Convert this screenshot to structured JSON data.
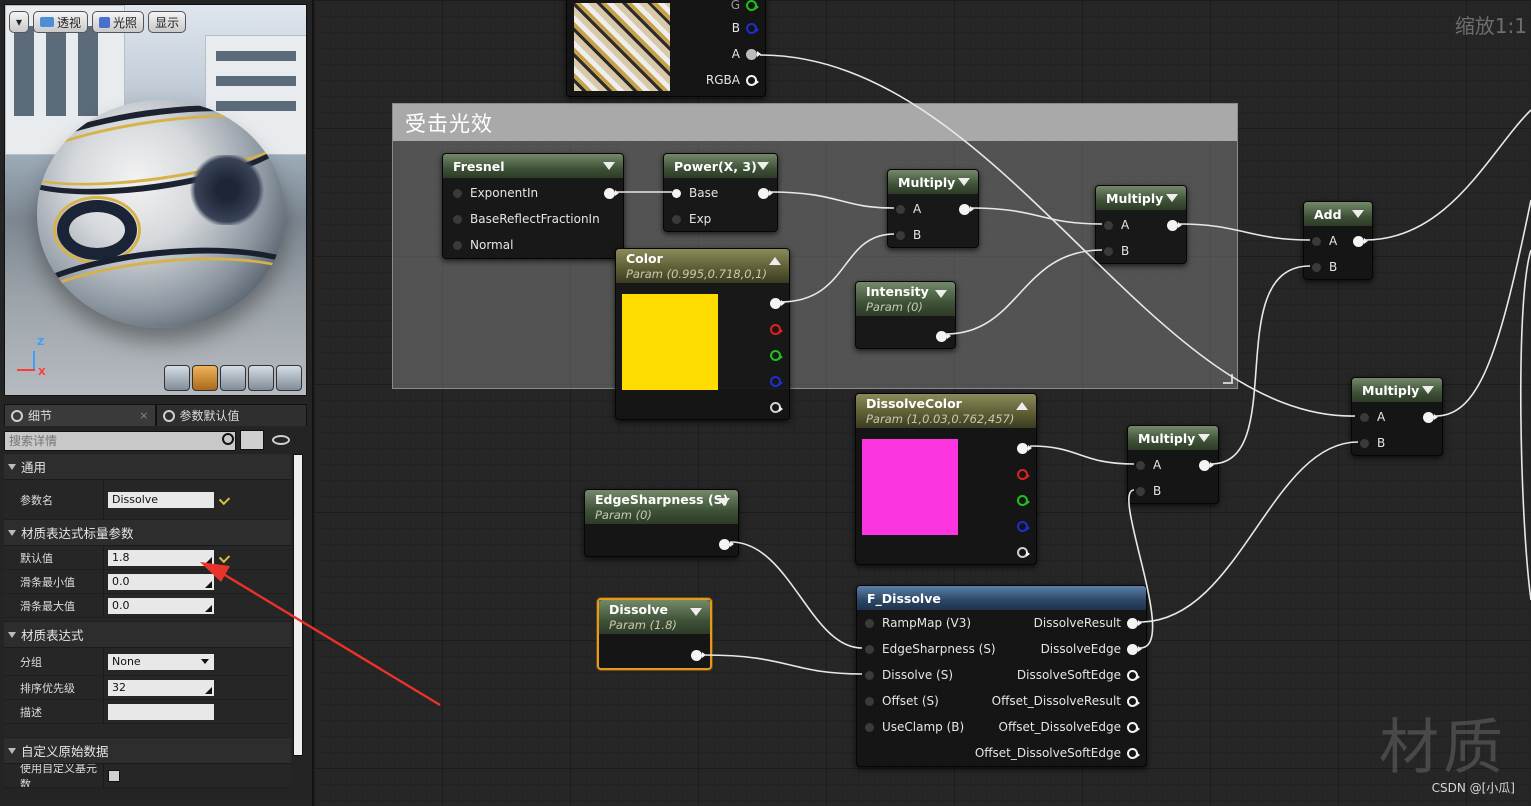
{
  "viewport": {
    "toolbar": {
      "menu_label": "▾",
      "perspective_label": "透视",
      "lighting_label": "光照",
      "show_label": "显示"
    },
    "axis": {
      "z": "Z",
      "x": "X"
    }
  },
  "details": {
    "tabs": [
      {
        "label": "细节",
        "close": "×"
      },
      {
        "label": "参数默认值",
        "close": ""
      }
    ],
    "search_placeholder": "搜索详情",
    "categories": [
      {
        "label": "通用",
        "rows": [
          {
            "label": "参数名",
            "value": "Dissolve"
          }
        ]
      },
      {
        "label": "材质表达式标量参数",
        "rows": [
          {
            "label": "默认值",
            "value": "1.8"
          },
          {
            "label": "滑条最小值",
            "value": "0.0"
          },
          {
            "label": "滑条最大值",
            "value": "0.0"
          }
        ]
      },
      {
        "label": "材质表达式",
        "rows": [
          {
            "label": "分组",
            "value": "None"
          },
          {
            "label": "排序优先级",
            "value": "32"
          },
          {
            "label": "描述",
            "value": ""
          }
        ]
      },
      {
        "label": "自定义原始数据",
        "rows": [
          {
            "label": "使用自定义基元数",
            "value": ""
          }
        ]
      }
    ]
  },
  "graph": {
    "zoom_label": "缩放1:1",
    "watermark": "材质",
    "credit": "CSDN @[小瓜]",
    "comment_title": "受击光效",
    "texture_pins": [
      "B",
      "A",
      "RGBA",
      "G"
    ],
    "nodes": {
      "fresnel": {
        "title": "Fresnel",
        "inputs": [
          "ExponentIn",
          "BaseReflectFractionIn",
          "Normal"
        ]
      },
      "power": {
        "title": "Power(X, 3)",
        "inputs": [
          "Base",
          "Exp"
        ]
      },
      "multiply1": {
        "title": "Multiply",
        "inputs": [
          "A",
          "B"
        ]
      },
      "multiply2": {
        "title": "Multiply",
        "inputs": [
          "A",
          "B"
        ]
      },
      "add": {
        "title": "Add",
        "inputs": [
          "A",
          "B"
        ]
      },
      "multiply3": {
        "title": "Multiply",
        "inputs": [
          "A",
          "B"
        ]
      },
      "multiply4": {
        "title": "Multiply",
        "inputs": [
          "A",
          "B"
        ]
      },
      "color": {
        "title": "Color",
        "subtitle": "Param (0.995,0.718,0,1)",
        "swatch": "#ffdc00"
      },
      "intensity": {
        "title": "Intensity",
        "subtitle": "Param (0)"
      },
      "dissolvecolor": {
        "title": "DissolveColor",
        "subtitle": "Param (1,0.03,0.762,457)",
        "swatch": "#fc35e0"
      },
      "edgesharpness": {
        "title": "EdgeSharpness (S)",
        "subtitle": "Param (0)"
      },
      "dissolve": {
        "title": "Dissolve",
        "subtitle": "Param (1.8)"
      },
      "fdissolve": {
        "title": "F_Dissolve",
        "inputs": [
          "RampMap (V3)",
          "EdgeSharpness (S)",
          "Dissolve (S)",
          "Offset (S)",
          "UseClamp (B)"
        ],
        "outputs": [
          "DissolveResult",
          "DissolveEdge",
          "DissolveSoftEdge",
          "Offset_DissolveResult",
          "Offset_DissolveEdge",
          "Offset_DissolveSoftEdge"
        ]
      }
    }
  },
  "colors": {
    "selection": "#e59a1e",
    "annotation_arrow": "#e8332a",
    "param_header": "#5b5b33",
    "function_header": "#2c4766",
    "math_header": "#3f5238"
  }
}
